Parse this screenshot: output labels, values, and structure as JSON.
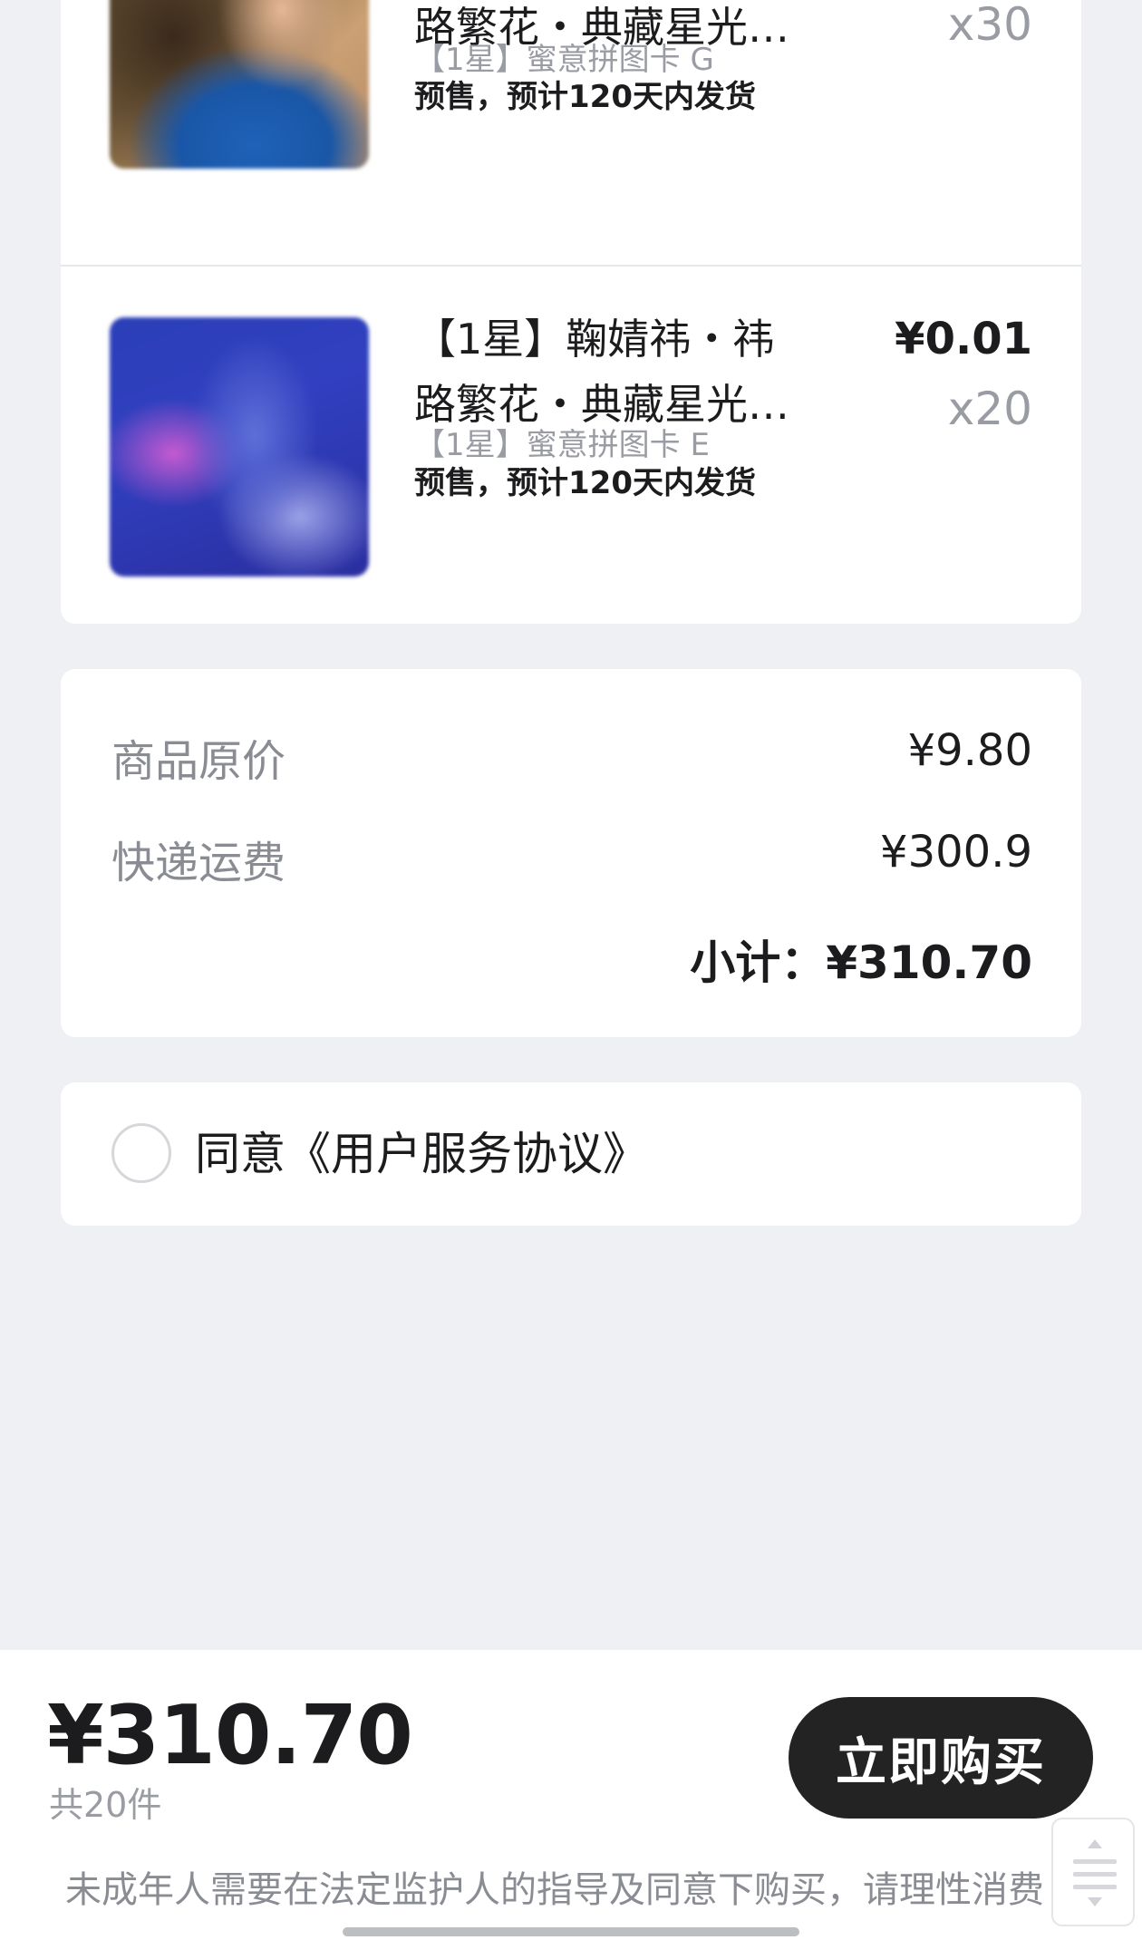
{
  "order_items": [
    {
      "title_line1": "",
      "title_line2": "路繁花・典藏星光…",
      "spec": "【1星】蜜意拼图卡 G",
      "presale": "预售，预计120天内发货",
      "price": "",
      "quantity": "x30"
    },
    {
      "title_line1": "【1星】鞠婧祎・祎",
      "title_line2": "路繁花・典藏星光…",
      "spec": "【1星】蜜意拼图卡 E",
      "presale": "预售，预计120天内发货",
      "price": "¥0.01",
      "quantity": "x20"
    }
  ],
  "summary": {
    "original_price_label": "商品原价",
    "original_price_value": "¥9.80",
    "shipping_label": "快递运费",
    "shipping_value": "¥300.9",
    "subtotal": "小计：¥310.70"
  },
  "agreement": {
    "text": "同意《用户服务协议》",
    "checked": false
  },
  "bottom_bar": {
    "total_price": "¥310.70",
    "total_count": "共20件",
    "buy_label": "立即购买",
    "notice": "未成年人需要在法定监护人的指导及同意下购买，请理性消费"
  },
  "icons": {
    "scroll_top": "scroll-to-top-icon"
  },
  "colors": {
    "background": "#eef0f4",
    "button": "#232323",
    "muted_text": "#9a9ca3"
  }
}
